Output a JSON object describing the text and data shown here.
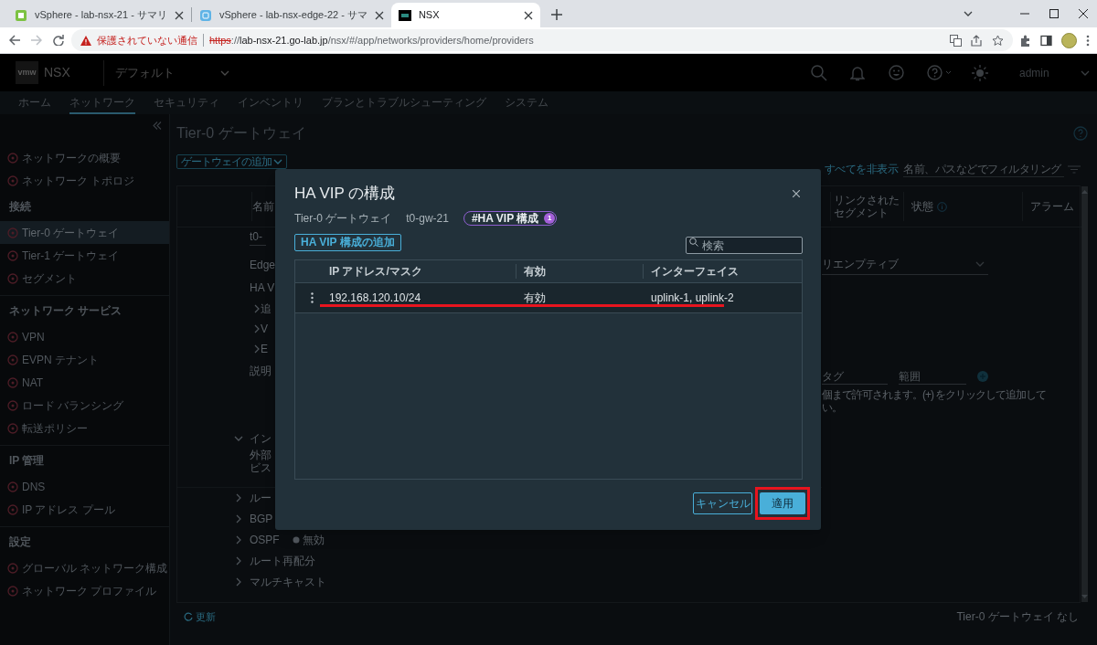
{
  "browser": {
    "tabs": [
      {
        "title": "vSphere - lab-nsx-21 - サマリ",
        "selected": false
      },
      {
        "title": "vSphere - lab-nsx-edge-22 - サマ",
        "selected": false
      },
      {
        "title": "NSX",
        "selected": true
      }
    ],
    "address_bar": {
      "security_label": "保護されていない通信",
      "url_parts": [
        {
          "text": "https",
          "kind": "scheme"
        },
        {
          "text": "://",
          "kind": "plain"
        },
        {
          "text": "lab-nsx-21.go-lab.jp",
          "kind": "host"
        },
        {
          "text": "/nsx/#/app/networks/providers/home/providers",
          "kind": "plain"
        }
      ]
    }
  },
  "nsx": {
    "logo": "vmw",
    "product": "NSX",
    "context": "デフォルト",
    "user": "admin",
    "nav": [
      {
        "label": "ホーム",
        "selected": false
      },
      {
        "label": "ネットワーク",
        "selected": true
      },
      {
        "label": "セキュリティ",
        "selected": false
      },
      {
        "label": "インベントリ",
        "selected": false
      },
      {
        "label": "プランとトラブルシューティング",
        "selected": false
      },
      {
        "label": "システム",
        "selected": false
      }
    ]
  },
  "sidebar": {
    "sections": [
      {
        "items": [
          {
            "label": "ネットワークの概要",
            "selected": false
          },
          {
            "label": "ネットワーク トポロジ",
            "selected": false
          }
        ]
      },
      {
        "header": "接続",
        "items": [
          {
            "label": "Tier-0 ゲートウェイ",
            "selected": true
          },
          {
            "label": "Tier-1 ゲートウェイ",
            "selected": false
          },
          {
            "label": "セグメント",
            "selected": false
          }
        ]
      },
      {
        "header": "ネットワーク サービス",
        "items": [
          {
            "label": "VPN",
            "selected": false
          },
          {
            "label": "EVPN テナント",
            "selected": false
          },
          {
            "label": "NAT",
            "selected": false
          },
          {
            "label": "ロード バランシング",
            "selected": false
          },
          {
            "label": "転送ポリシー",
            "selected": false
          }
        ]
      },
      {
        "header": "IP 管理",
        "items": [
          {
            "label": "DNS",
            "selected": false
          },
          {
            "label": "IP アドレス プール",
            "selected": false
          }
        ]
      },
      {
        "header": "設定",
        "items": [
          {
            "label": "グローバル ネットワーク構成",
            "selected": false
          },
          {
            "label": "ネットワーク プロファイル",
            "selected": false
          }
        ]
      }
    ]
  },
  "page": {
    "title": "Tier-0 ゲートウェイ",
    "add_button": "ゲートウェイの追加",
    "collapse_all": "すべてを非表示",
    "filter_placeholder": "名前、パスなどでフィルタリング",
    "table": {
      "columns": [
        "名前",
        "リンクされたセグメント",
        "状態",
        "アラーム"
      ],
      "details": [
        {
          "kind": "input",
          "label": "t0-"
        },
        {
          "kind": "field",
          "label": "Edge"
        },
        {
          "kind": "field",
          "label": "HA V"
        },
        {
          "kind": "sub",
          "label": "追"
        },
        {
          "kind": "sub",
          "label": "V"
        },
        {
          "kind": "sub",
          "label": "E"
        },
        {
          "kind": "textarea",
          "label": "説明"
        },
        {
          "kind": "section",
          "label": "イン",
          "expanded": true
        },
        {
          "kind": "text",
          "label": "外部"
        },
        {
          "kind": "text",
          "label": "ビス"
        },
        {
          "kind": "section",
          "label": "ルー",
          "expanded": false
        },
        {
          "kind": "section",
          "label": "BGP",
          "expanded": false
        },
        {
          "kind": "section",
          "label": "OSPF",
          "expanded": false,
          "value": "無効"
        },
        {
          "kind": "section",
          "label": "ルート再配分",
          "expanded": false
        },
        {
          "kind": "section",
          "label": "マルチキャスト",
          "expanded": false
        }
      ],
      "right_details": {
        "dropdown": "リエンプティブ",
        "tag_placeholder": "タグ",
        "scope_placeholder": "範囲",
        "help": [
          "個まで許可されます。(+) をクリックして追加して",
          "い。"
        ]
      }
    },
    "footer": {
      "refresh": "更新",
      "status": "Tier-0 ゲートウェイ なし"
    }
  },
  "dialog": {
    "title": "HA VIP の構成",
    "gateway_type": "Tier-0 ゲートウェイ",
    "gateway_name": "t0-gw-21",
    "tag": "#HA VIP 構成",
    "tag_count": "1",
    "add_button": "HA VIP 構成の追加",
    "search_placeholder": "検索",
    "columns": [
      "IP アドレス/マスク",
      "有効",
      "インターフェイス"
    ],
    "rows": [
      {
        "ip": "192.168.120.10/24",
        "enabled": "有効",
        "interfaces": "uplink-1, uplink-2"
      }
    ],
    "cancel": "キャンセル",
    "apply": "適用"
  }
}
